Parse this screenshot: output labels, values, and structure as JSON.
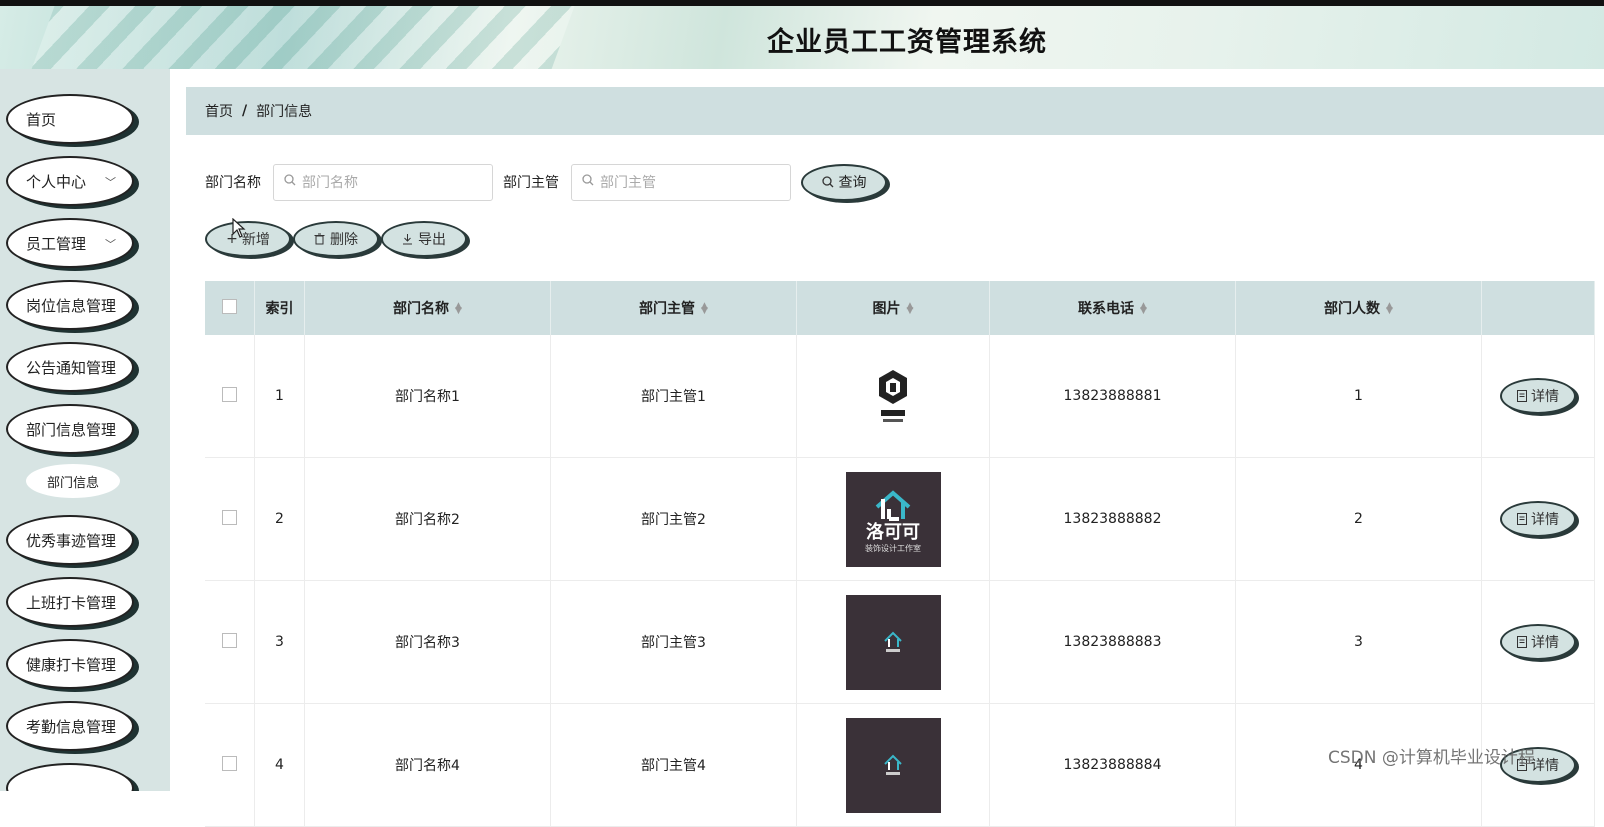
{
  "app": {
    "title": "企业员工工资管理系统"
  },
  "sidebar": {
    "items": [
      {
        "label": "首页",
        "chevron": false
      },
      {
        "label": "个人中心",
        "chevron": true
      },
      {
        "label": "员工管理",
        "chevron": true
      },
      {
        "label": "岗位信息管理",
        "chevron": false
      },
      {
        "label": "公告通知管理",
        "chevron": false
      },
      {
        "label": "部门信息管理",
        "chevron": false
      },
      {
        "label": "优秀事迹管理",
        "chevron": false
      },
      {
        "label": "上班打卡管理",
        "chevron": false
      },
      {
        "label": "健康打卡管理",
        "chevron": false
      },
      {
        "label": "考勤信息管理",
        "chevron": false
      }
    ],
    "sub_item": "部门信息"
  },
  "breadcrumb": {
    "home": "首页",
    "sep": "/",
    "current": "部门信息"
  },
  "search": {
    "name_label": "部门名称",
    "name_placeholder": "部门名称",
    "manager_label": "部门主管",
    "manager_placeholder": "部门主管",
    "query_label": "查询"
  },
  "actions": {
    "add": "新增",
    "delete": "删除",
    "export": "导出"
  },
  "table": {
    "headers": [
      "索引",
      "部门名称",
      "部门主管",
      "图片",
      "联系电话",
      "部门人数"
    ],
    "rows": [
      {
        "index": "1",
        "name": "部门名称1",
        "manager": "部门主管1",
        "phone": "13823888881",
        "count": "1"
      },
      {
        "index": "2",
        "name": "部门名称2",
        "manager": "部门主管2",
        "phone": "13823888882",
        "count": "2"
      },
      {
        "index": "3",
        "name": "部门名称3",
        "manager": "部门主管3",
        "phone": "13823888883",
        "count": "3"
      },
      {
        "index": "4",
        "name": "部门名称4",
        "manager": "部门主管4",
        "phone": "13823888884",
        "count": "4"
      }
    ],
    "detail_label": "详情",
    "thumb_text_2": "洛可可",
    "thumb_sub_2": "装饰设计工作室"
  },
  "watermark": "CSDN @计算机毕业设计程",
  "colors": {
    "accent": "#cfdfe0",
    "sidebar_bg": "#d7e4e3",
    "button_fill": "#d3e2e1"
  }
}
